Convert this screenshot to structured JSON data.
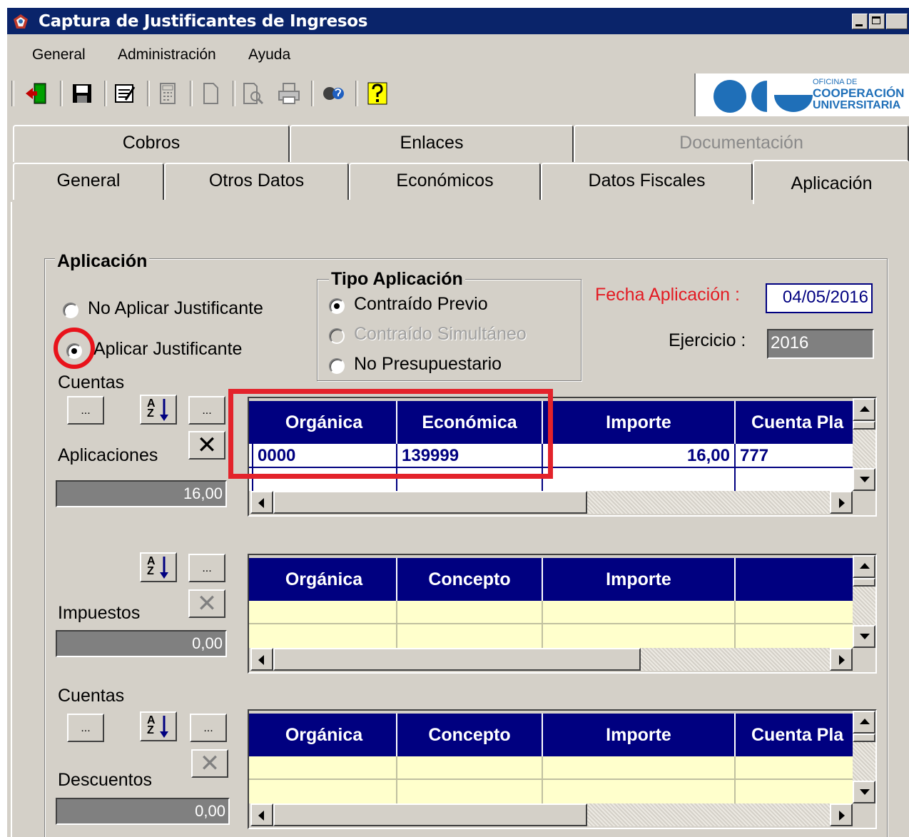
{
  "window": {
    "title": "Captura de Justificantes de Ingresos"
  },
  "menu": [
    "General",
    "Administración",
    "Ayuda"
  ],
  "logo": {
    "line1": "OFICINA DE",
    "line2": "COOPERACIÓN",
    "line3": "UNIVERSITARIA"
  },
  "tabs_row1": [
    {
      "label": "Cobros",
      "enabled": true
    },
    {
      "label": "Enlaces",
      "enabled": true
    },
    {
      "label": "Documentación",
      "enabled": false
    }
  ],
  "tabs_row2": [
    {
      "label": "General"
    },
    {
      "label": "Otros Datos"
    },
    {
      "label": "Económicos"
    },
    {
      "label": "Datos Fiscales"
    },
    {
      "label": "Aplicación",
      "active": true
    }
  ],
  "aplicacion": {
    "group_label": "Aplicación",
    "radio_no": "No Aplicar Justificante",
    "radio_si": "Aplicar Justificante",
    "selected": "Aplicar Justificante"
  },
  "tipo": {
    "group_label": "Tipo Aplicación",
    "options": [
      "Contraído Previo",
      "Contraído Simultáneo",
      "No Presupuestario"
    ],
    "selected": "Contraído Previo"
  },
  "fecha": {
    "label": "Fecha Aplicación :",
    "value": "04/05/2016"
  },
  "ejercicio": {
    "label": "Ejercicio :",
    "value": "2016"
  },
  "colors": {
    "fecha_label": "#e31b23",
    "grid_header": "#000080",
    "annotation": "#e3232b"
  },
  "section1": {
    "cuentas_label": "Cuentas",
    "aplicaciones_label": "Aplicaciones",
    "total": "16,00",
    "ellipsis": "...",
    "sort_top": "A",
    "sort_bottom": "Z",
    "columns": [
      "Orgánica",
      "Económica",
      "Importe",
      "Cuenta Pla"
    ],
    "rows": [
      [
        "0000",
        "139999",
        "16,00",
        "777"
      ]
    ]
  },
  "section2": {
    "impuestos_label": "Impuestos",
    "total": "0,00",
    "ellipsis": "...",
    "sort_top": "A",
    "sort_bottom": "Z",
    "columns": [
      "Orgánica",
      "Concepto",
      "Importe",
      ""
    ]
  },
  "section3": {
    "cuentas_label": "Cuentas",
    "descuentos_label": "Descuentos",
    "total": "0,00",
    "ellipsis": "...",
    "sort_top": "A",
    "sort_bottom": "Z",
    "columns": [
      "Orgánica",
      "Concepto",
      "Importe",
      "Cuenta Pla"
    ]
  }
}
